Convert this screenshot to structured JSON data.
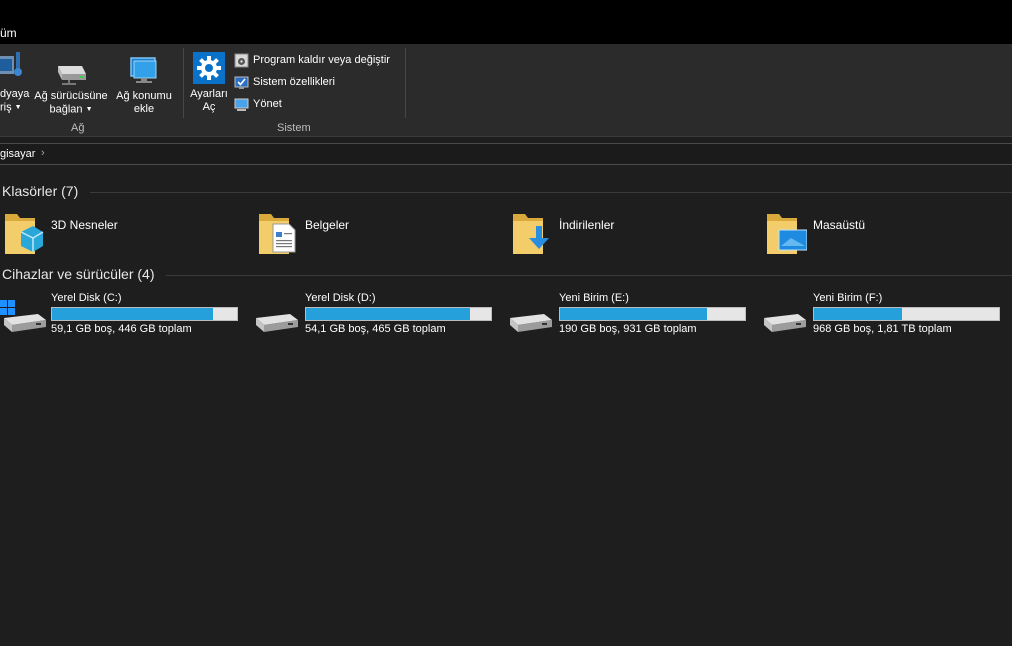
{
  "menubar": {
    "active_tab": "üm"
  },
  "ribbon": {
    "media_button": {
      "line1": "dyaya",
      "line2": "riş"
    },
    "map_drive_button": {
      "line1": "Ağ sürücüsüne",
      "line2": "bağlan"
    },
    "add_location_button": {
      "line1": "Ağ konumu",
      "line2": "ekle"
    },
    "network_group_label": "Ağ",
    "settings_button": {
      "line1": "Ayarları",
      "line2": "Aç"
    },
    "uninstall_item": "Program kaldır veya değiştir",
    "system_props_item": "Sistem özellikleri",
    "manage_item": "Yönet",
    "system_group_label": "Sistem"
  },
  "address": {
    "crumb": "gisayar"
  },
  "folders": {
    "header": "Klasörler (7)",
    "items": [
      {
        "name": "3D Nesneler",
        "icon": "3d-objects-folder-icon"
      },
      {
        "name": "Belgeler",
        "icon": "documents-folder-icon"
      },
      {
        "name": "İndirilenler",
        "icon": "downloads-folder-icon"
      },
      {
        "name": "Masaüstü",
        "icon": "desktop-folder-icon"
      }
    ]
  },
  "drives": {
    "header": "Cihazlar ve sürücüler (4)",
    "items": [
      {
        "name": "Yerel Disk (C:)",
        "size": "59,1 GB boş, 446 GB toplam",
        "used_fraction": 0.868,
        "icon": "windows-drive-icon"
      },
      {
        "name": "Yerel Disk (D:)",
        "size": "54,1 GB boş, 465 GB toplam",
        "used_fraction": 0.884,
        "icon": "hard-drive-icon"
      },
      {
        "name": "Yeni Birim (E:)",
        "size": "190 GB boş, 931 GB toplam",
        "used_fraction": 0.796,
        "icon": "hard-drive-icon"
      },
      {
        "name": "Yeni Birim (F:)",
        "size": "968 GB boş, 1,81 TB toplam",
        "used_fraction": 0.478,
        "icon": "hard-drive-icon"
      }
    ]
  },
  "colors": {
    "accent": "#26a0da",
    "background": "#1e1e1e",
    "ribbon": "#2b2b2b",
    "folder": "#e8c46a"
  }
}
